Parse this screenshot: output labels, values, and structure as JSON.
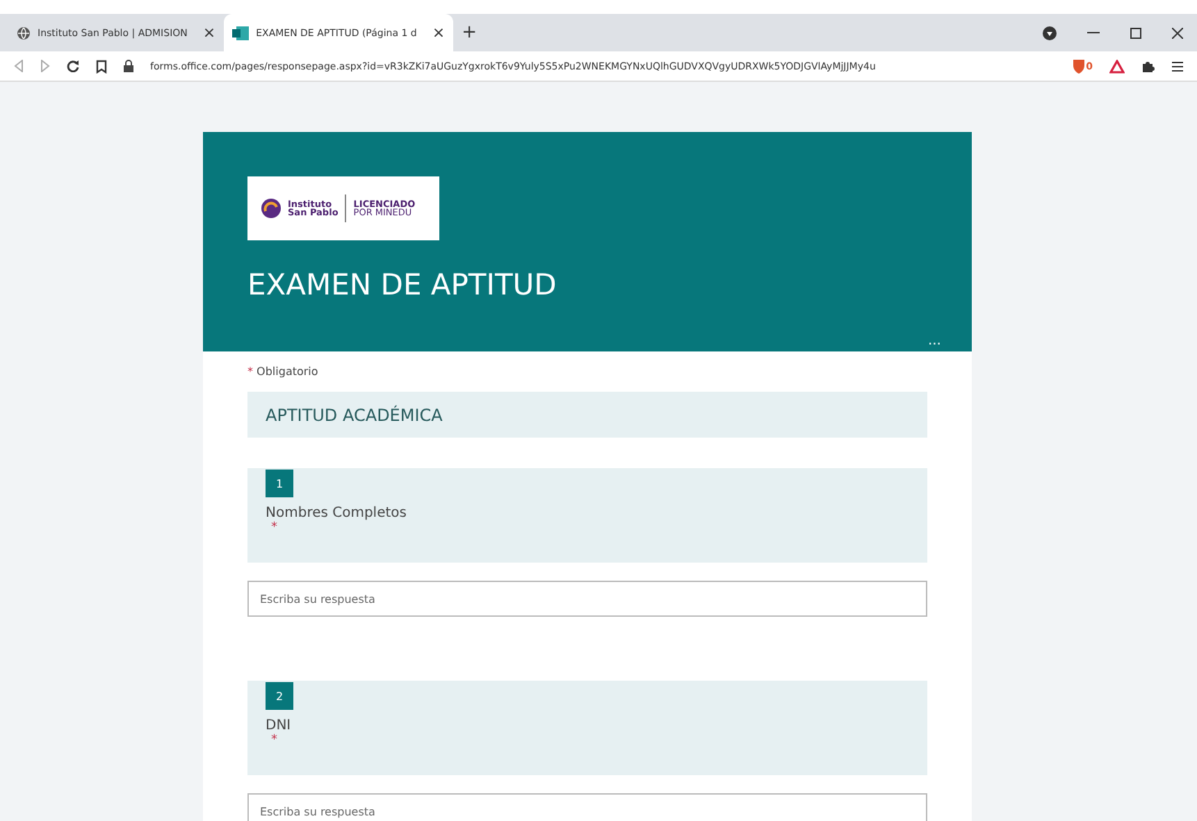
{
  "browser": {
    "tabs": [
      {
        "title": "Instituto San Pablo | ADMISION",
        "close": "×",
        "selected": false
      },
      {
        "title": "EXAMEN DE APTITUD (Página 1 d",
        "close": "×",
        "selected": true
      }
    ],
    "new_tab": "+",
    "url": "forms.office.com/pages/responsepage.aspx?id=vR3kZKi7aUGuzYgxrokT6v9Yuly5S5xPu2WNEKMGYNxUQlhGUDVXQVgyUDRXWk5YODJGVlAyMjJJMy4u",
    "shield_count": "0"
  },
  "form": {
    "logo": {
      "name_line1": "Instituto",
      "name_line2": "San Pablo",
      "badge_line1": "LICENCIADO",
      "badge_line2": "POR MINEDU"
    },
    "title": "EXAMEN DE APTITUD",
    "more": "...",
    "required_note": {
      "mark": "*",
      "text": "Obligatorio"
    },
    "section": "APTITUD ACADÉMICA",
    "questions": [
      {
        "number": "1",
        "label": "Nombres Completos",
        "required_mark": "*",
        "placeholder": "Escriba su respuesta"
      },
      {
        "number": "2",
        "label": "DNI",
        "required_mark": "*",
        "placeholder": "Escriba su respuesta"
      }
    ]
  }
}
